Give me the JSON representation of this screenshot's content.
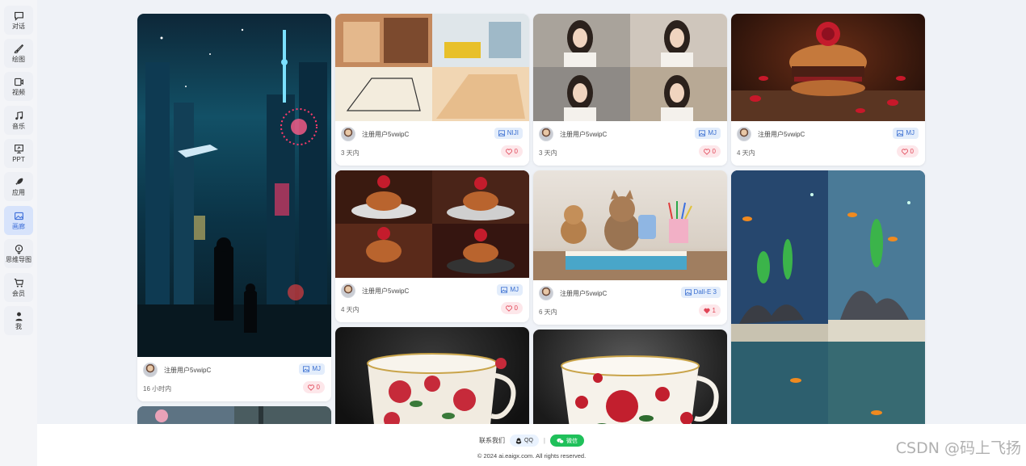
{
  "sidebar": {
    "items": [
      {
        "label": "对话",
        "icon": "chat-icon"
      },
      {
        "label": "绘图",
        "icon": "brush-icon"
      },
      {
        "label": "视频",
        "icon": "video-icon"
      },
      {
        "label": "音乐",
        "icon": "music-icon"
      },
      {
        "label": "PPT",
        "icon": "presentation-icon"
      },
      {
        "label": "应用",
        "icon": "rocket-icon"
      },
      {
        "label": "画廊",
        "icon": "gallery-icon"
      },
      {
        "label": "思维导图",
        "icon": "mindmap-icon"
      },
      {
        "label": "会员",
        "icon": "cart-icon"
      },
      {
        "label": "我",
        "icon": "user-icon"
      }
    ],
    "active_index": 6
  },
  "gallery": {
    "cards": [
      {
        "user": "注册用户5vwipC",
        "model": "MJ",
        "time": "16 小时内",
        "likes": "0",
        "liked": false,
        "image": "cyberpunk-city-night"
      },
      {
        "user": "注册用户5vwipC",
        "model": "NIJI",
        "time": "3 天内",
        "likes": "0",
        "liked": false,
        "image": "loft-interior-grid"
      },
      {
        "user": "注册用户5vwipC",
        "model": "MJ",
        "time": "3 天内",
        "likes": "0",
        "liked": false,
        "image": "portrait-grid"
      },
      {
        "user": "注册用户5vwipC",
        "model": "MJ",
        "time": "4 天内",
        "likes": "0",
        "liked": false,
        "image": "rose-burger"
      },
      {
        "user": "注册用户5vwipC",
        "model": "MJ",
        "time": "4 天内",
        "likes": "0",
        "liked": false,
        "image": "rose-burger-grid"
      },
      {
        "user": "注册用户5vwipC",
        "model": "Dall-E 3",
        "time": "6 天内",
        "likes": "1",
        "liked": true,
        "image": "kitten-backpack"
      },
      {
        "image": "rose-teacup-1"
      },
      {
        "image": "rose-teacup-2"
      },
      {
        "image": "aquarium-grid"
      },
      {
        "image": "forest-partial"
      }
    ]
  },
  "footer": {
    "contact_label": "联系我们",
    "qq_label": "QQ",
    "wechat_label": "微信",
    "copyright": "© 2024 ai.eaigx.com. All rights reserved."
  },
  "watermark": "CSDN @码上飞扬",
  "colors": {
    "accent": "#3e6fd9",
    "like": "#e04455",
    "wechat": "#1fc05a",
    "background": "#eff2f7"
  }
}
